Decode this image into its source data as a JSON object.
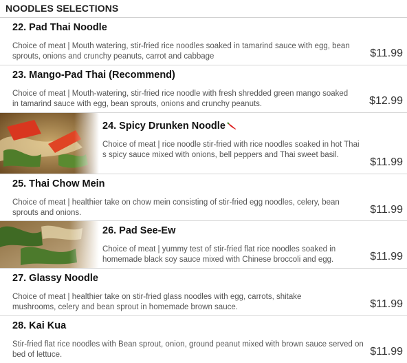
{
  "section": {
    "title": "NOODLES SELECTIONS"
  },
  "items": [
    {
      "name": "22. Pad Thai Noodle",
      "desc": "Choice of meat | Mouth watering, stir-fried rice noodles soaked in tamarind sauce with egg, bean sprouts, onions and crunchy peanuts, carrot and cabbage",
      "price": "$11.99"
    },
    {
      "name": "23. Mango-Pad Thai (Recommend)",
      "desc": "Choice of meat | Mouth-watering, stir-fried rice noodle with fresh shredded green mango soaked in tamarind sauce with egg, bean sprouts, onions and crunchy peanuts.",
      "price": "$12.99"
    },
    {
      "name": "24. Spicy Drunken Noodle",
      "desc": "Choice of meat | rice noodle stir-fried with rice noodles soaked in hot Thai s spicy sauce mixed with onions, bell peppers and Thai sweet basil.",
      "price": "$11.99",
      "icon": "chili-icon"
    },
    {
      "name": "25. Thai Chow Mein",
      "desc": "Choice of meat | healthier take on chow mein consisting of stir-fried egg noodles, celery, bean sprouts and onions.",
      "price": "$11.99"
    },
    {
      "name": "26. Pad See-Ew",
      "desc": "Choice of meat | yummy test of stir-fried flat rice noodles soaked in homemade black soy sauce mixed with Chinese broccoli and egg.",
      "price": "$11.99"
    },
    {
      "name": "27. Glassy Noodle",
      "desc": "Choice of meat | healthier take on stir-fried glass noodles with egg, carrots, shitake mushrooms, celery and bean sprout in homemade brown sauce.",
      "price": "$11.99"
    },
    {
      "name": "28. Kai Kua",
      "desc": "Stir-fried flat rice noodles with Bean sprout, onion, ground peanut mixed with brown sauce served on bed of lettuce.",
      "price": "$11.99"
    }
  ]
}
